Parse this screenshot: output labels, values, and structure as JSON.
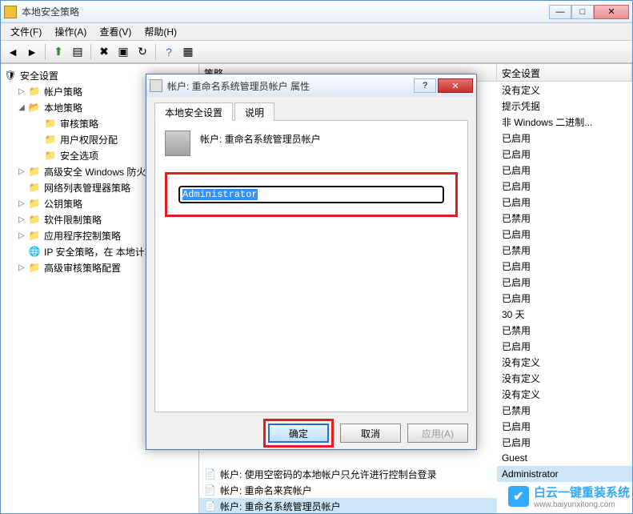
{
  "window": {
    "title": "本地安全策略"
  },
  "menu": {
    "file": "文件(F)",
    "action": "操作(A)",
    "view": "查看(V)",
    "help": "帮助(H)"
  },
  "tree": {
    "root": "安全设置",
    "items": [
      "帐户策略",
      "本地策略",
      "审核策略",
      "用户权限分配",
      "安全选项",
      "高级安全 Windows 防火",
      "网络列表管理器策略",
      "公钥策略",
      "软件限制策略",
      "应用程序控制策略",
      "IP 安全策略，在 本地计算",
      "高级审核策略配置"
    ]
  },
  "list": {
    "header_policy": "策略",
    "header_setting": "安全设置",
    "settings": [
      "没有定义",
      "提示凭据",
      "非 Windows 二进制...",
      "已启用",
      "已启用",
      "已启用",
      "已启用",
      "已启用",
      "已禁用",
      "已启用",
      "已禁用",
      "已启用",
      "已启用",
      "已启用",
      "30 天",
      "已禁用",
      "已启用",
      "没有定义",
      "没有定义",
      "没有定义",
      "已禁用",
      "已启用"
    ],
    "bottom_rows": [
      "帐户: 使用空密码的本地帐户只允许进行控制台登录",
      "帐户: 重命名来宾帐户",
      "帐户: 重命名系统管理员帐户"
    ],
    "bottom_settings": [
      "已启用",
      "Guest",
      "Administrator"
    ]
  },
  "dialog": {
    "title": "帐户: 重命名系统管理员帐户 属性",
    "tab_local": "本地安全设置",
    "tab_explain": "说明",
    "policy_label": "帐户: 重命名系统管理员帐户",
    "input_value": "Administrator",
    "btn_ok": "确定",
    "btn_cancel": "取消",
    "btn_apply": "应用(A)"
  },
  "watermark": {
    "text": "白云一键重装系统",
    "url": "www.baiyunxitong.com"
  }
}
